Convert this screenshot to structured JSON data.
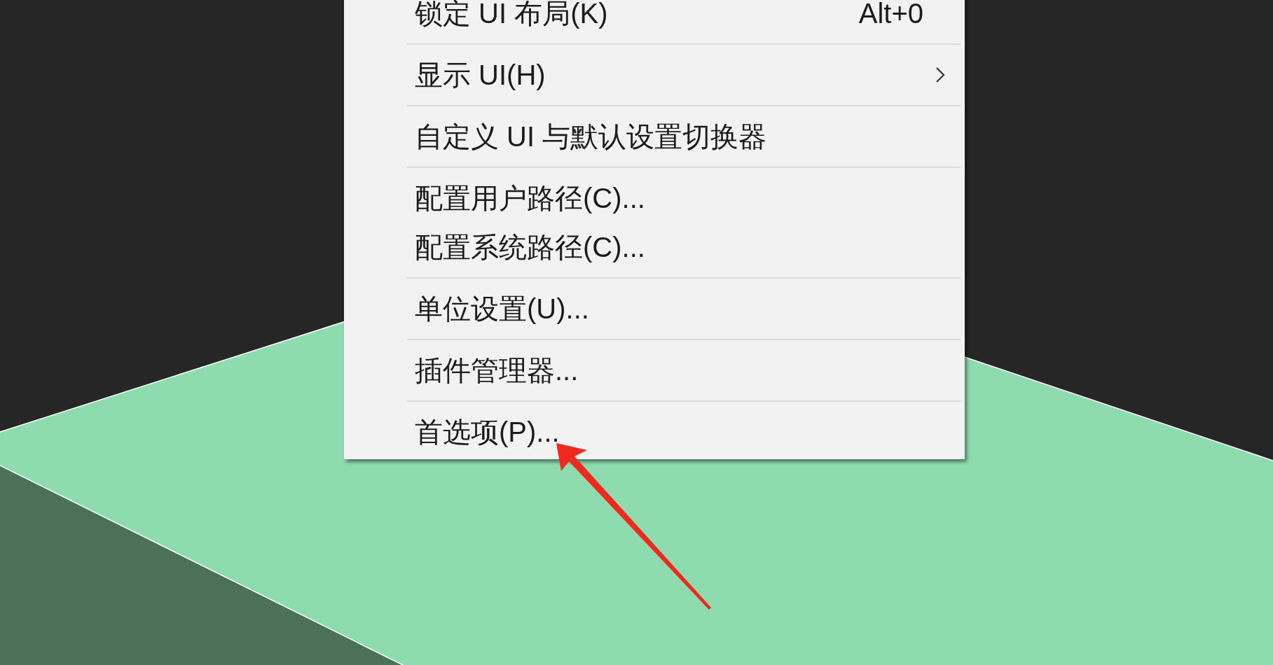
{
  "menu": {
    "groups": [
      {
        "items": [
          {
            "label": "锁定 UI 布局(K)",
            "shortcut": "Alt+0",
            "submenu": false
          }
        ]
      },
      {
        "items": [
          {
            "label": "显示 UI(H)",
            "submenu": true
          }
        ]
      },
      {
        "items": [
          {
            "label": "自定义 UI 与默认设置切换器",
            "submenu": false
          }
        ]
      },
      {
        "items": [
          {
            "label": "配置用户路径(C)...",
            "submenu": false
          },
          {
            "label": "配置系统路径(C)...",
            "submenu": false
          }
        ]
      },
      {
        "items": [
          {
            "label": "单位设置(U)...",
            "submenu": false
          }
        ]
      },
      {
        "items": [
          {
            "label": "插件管理器...",
            "submenu": false
          }
        ]
      },
      {
        "items": [
          {
            "label": "首选项(P)...",
            "submenu": false
          }
        ]
      }
    ]
  }
}
